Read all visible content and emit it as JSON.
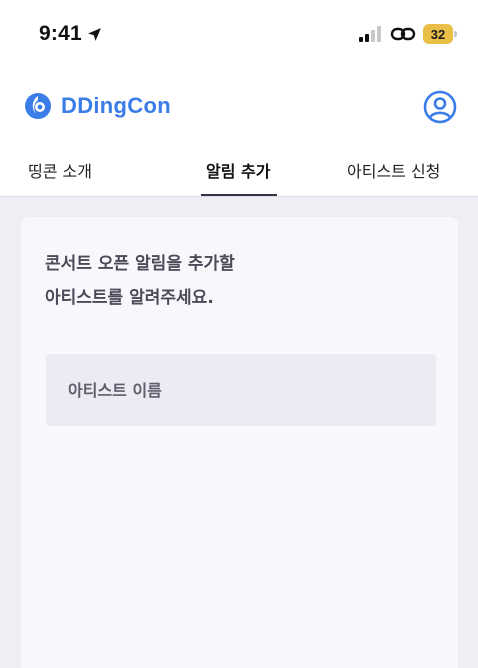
{
  "status_bar": {
    "time": "9:41",
    "battery_level": "32",
    "battery_color": "#e9bf47",
    "icons": [
      "location-arrow-icon",
      "cellular-signal-icon",
      "link-icon",
      "battery-icon"
    ]
  },
  "header": {
    "brand": "DDingCon",
    "brand_color": "#3b7de8",
    "icons": [
      "ddingcon-logo-icon",
      "profile-icon"
    ]
  },
  "tabs": [
    {
      "label": "띵콘 소개",
      "active": false
    },
    {
      "label": "알림 추가",
      "active": true
    },
    {
      "label": "아티스트 신청",
      "active": false
    }
  ],
  "card": {
    "heading_line1": "콘서트 오픈 알림을 추가할",
    "heading_line2": "아티스트를 알려주세요.",
    "artist_input": {
      "value": "",
      "placeholder": "아티스트 이름"
    }
  }
}
